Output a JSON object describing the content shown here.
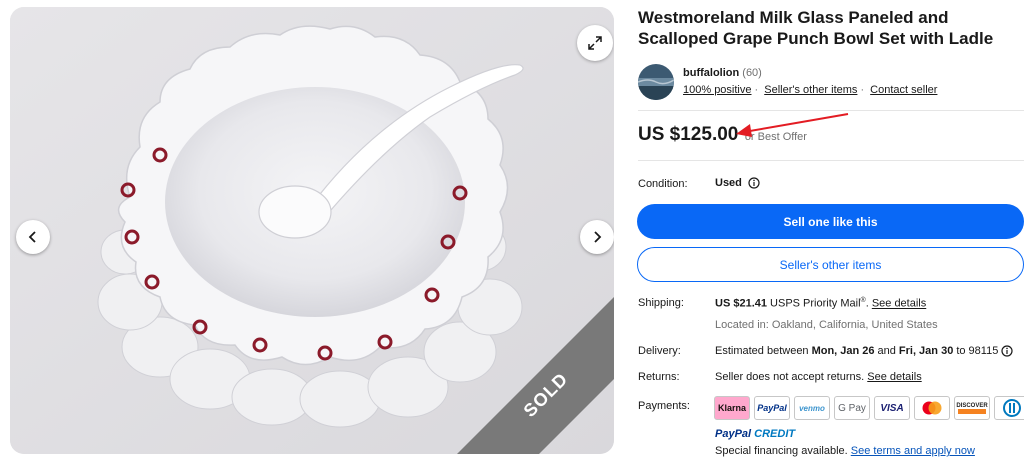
{
  "listing": {
    "title": "Westmoreland Milk Glass Paneled and Scalloped Grape Punch Bowl Set with Ladle",
    "sold_label": "SOLD"
  },
  "seller": {
    "name": "buffalolion",
    "count": "(60)",
    "feedback": "100% positive",
    "other_items": "Seller's other items",
    "contact": "Contact seller",
    "separator": "·"
  },
  "price": {
    "amount": "US $125.00",
    "offer": "or Best Offer"
  },
  "condition": {
    "label": "Condition:",
    "value": "Used"
  },
  "buttons": {
    "primary": "Sell one like this",
    "secondary": "Seller's other items"
  },
  "shipping": {
    "label": "Shipping:",
    "cost": "US $21.41",
    "service": "USPS Priority Mail",
    "reg": "®",
    "details_link": "See details",
    "location": "Located in: Oakland, California, United States"
  },
  "delivery": {
    "label": "Delivery:",
    "prefix": "Estimated between",
    "start": "Mon, Jan 26",
    "and": "and",
    "end": "Fri, Jan 30",
    "to": "to 98115"
  },
  "returns": {
    "label": "Returns:",
    "text": "Seller does not accept returns.",
    "details_link": "See details"
  },
  "payments": {
    "label": "Payments:",
    "methods": [
      "Klarna",
      "PayPal",
      "venmo",
      "G Pay",
      "VISA",
      "Mastercard",
      "DISCOVER",
      "Diners Club"
    ],
    "paypal_credit_1": "PayPal",
    "paypal_credit_2": "CREDIT",
    "financing_text": "Special financing available.",
    "financing_link": "See terms and apply now"
  },
  "colors": {
    "primary_blue": "#0968f6",
    "annotation_red": "#e31c23"
  },
  "icons": {
    "prev": "chevron-left-icon",
    "next": "chevron-right-icon",
    "expand": "expand-icon",
    "info": "info-icon"
  }
}
